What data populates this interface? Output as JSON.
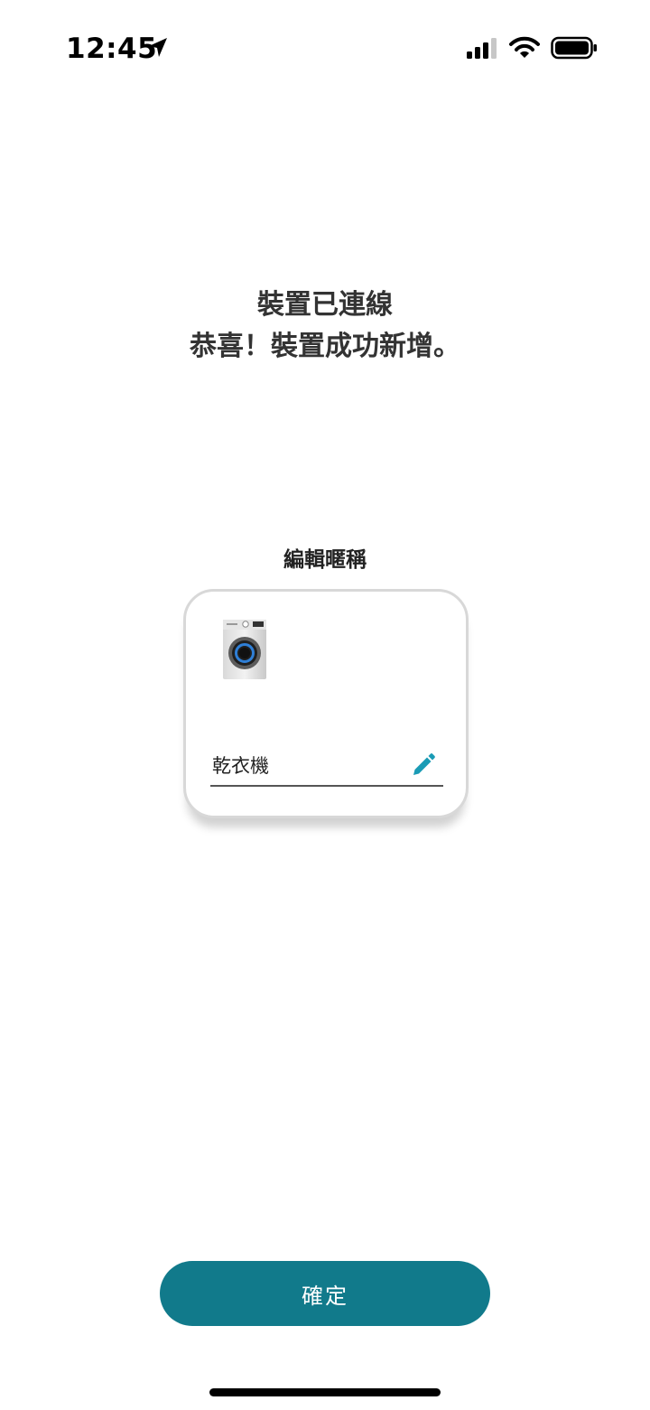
{
  "status_bar": {
    "time": "12:45",
    "icons": [
      "location-arrow-icon",
      "cellular-signal-icon",
      "wifi-icon",
      "battery-icon"
    ]
  },
  "header": {
    "line1": "裝置已連線",
    "line2": "恭喜！裝置成功新增。"
  },
  "nickname": {
    "label": "編輯暱稱",
    "value": "乾衣機",
    "edit_icon": "pencil-icon",
    "device_icon": "dryer-appliance-icon"
  },
  "actions": {
    "confirm_label": "確定"
  },
  "colors": {
    "primary": "#117a8b",
    "pencil": "#1a9bb5",
    "card_border": "#d8d8d8"
  }
}
